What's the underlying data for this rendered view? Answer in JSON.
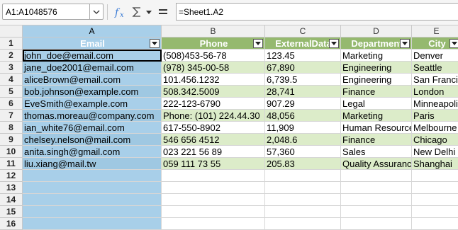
{
  "formula_bar": {
    "name_box": "A1:A1048576",
    "formula": "=Sheet1.A2"
  },
  "columns": [
    {
      "letter": "A"
    },
    {
      "letter": "B"
    },
    {
      "letter": "C"
    },
    {
      "letter": "D"
    },
    {
      "letter": "E"
    }
  ],
  "headers": [
    "Email",
    "Phone",
    "ExternalData",
    "Department",
    "City"
  ],
  "rows": [
    {
      "num": "1"
    },
    {
      "num": "2",
      "cells": [
        "john_doe@email.com",
        "(508)453-56-78",
        "123.45",
        "Marketing",
        "Denver"
      ]
    },
    {
      "num": "3",
      "cells": [
        "jane_doe2001@email.com",
        "(978) 345-00-58",
        "67,890",
        "Engineering",
        "Seattle"
      ]
    },
    {
      "num": "4",
      "cells": [
        "aliceBrown@email.com",
        "101.456.1232",
        "6,739.5",
        "Engineering",
        "San Francisco"
      ]
    },
    {
      "num": "5",
      "cells": [
        "bob.johnson@example.com",
        "508.342.5009",
        "28,741",
        "Finance",
        "London"
      ]
    },
    {
      "num": "6",
      "cells": [
        "EveSmith@example.com",
        "222-123-6790",
        "907.29",
        "Legal",
        "Minneapolis"
      ]
    },
    {
      "num": "7",
      "cells": [
        "thomas.moreau@company.com",
        "Phone: (101) 224.44.30",
        "48,056",
        "Marketing",
        "Paris"
      ]
    },
    {
      "num": "8",
      "cells": [
        "ian_white76@email.com",
        "617-550-8902",
        "11,909",
        "Human Resources",
        "Melbourne"
      ]
    },
    {
      "num": "9",
      "cells": [
        "chelsey.nelson@mail.com",
        "546 656 4512",
        "2,048.6",
        "Finance",
        "Chicago"
      ]
    },
    {
      "num": "10",
      "cells": [
        "anita.singh@gmail.com",
        "023 221 56 89",
        "57,360",
        "Sales",
        "New Delhi"
      ]
    },
    {
      "num": "11",
      "cells": [
        "liu.xiang@mail.tw",
        "059 111 73 55",
        "205.83",
        "Quality Assurance",
        "Shanghai"
      ]
    },
    {
      "num": "12",
      "cells": [
        "",
        "",
        "",
        "",
        ""
      ]
    },
    {
      "num": "13",
      "cells": [
        "",
        "",
        "",
        "",
        ""
      ]
    },
    {
      "num": "14",
      "cells": [
        "",
        "",
        "",
        "",
        ""
      ]
    },
    {
      "num": "15",
      "cells": [
        "",
        "",
        "",
        "",
        ""
      ]
    },
    {
      "num": "16",
      "cells": [
        "",
        "",
        "",
        "",
        ""
      ]
    }
  ]
}
